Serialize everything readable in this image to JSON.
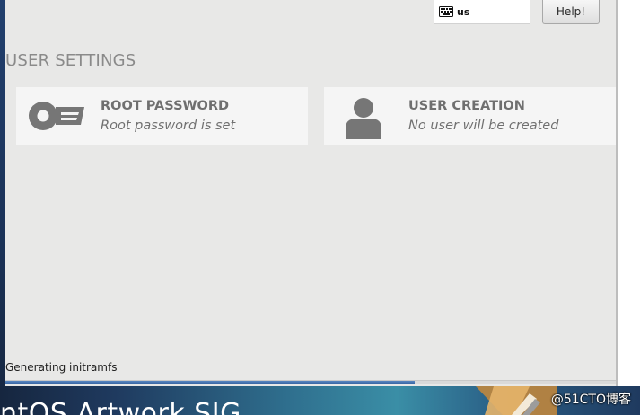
{
  "header": {
    "keyboard_layout": "us",
    "help_label": "Help!"
  },
  "section": {
    "title": "USER SETTINGS"
  },
  "spokes": {
    "root_password": {
      "title": "ROOT PASSWORD",
      "status": "Root password is set",
      "icon": "key-icon"
    },
    "user_creation": {
      "title": "USER CREATION",
      "status": "No user will be created",
      "icon": "user-icon"
    }
  },
  "progress": {
    "label": "Generating initramfs",
    "fraction": 0.67
  },
  "banner": {
    "text": "ntOS Artwork SIG"
  },
  "watermark": {
    "text": "@51CTO博客"
  },
  "colors": {
    "panel_bg": "#e8e8e7",
    "spoke_bg": "#f5f5f5",
    "icon_gray": "#767676",
    "progress_blue": "#2c5a98"
  }
}
